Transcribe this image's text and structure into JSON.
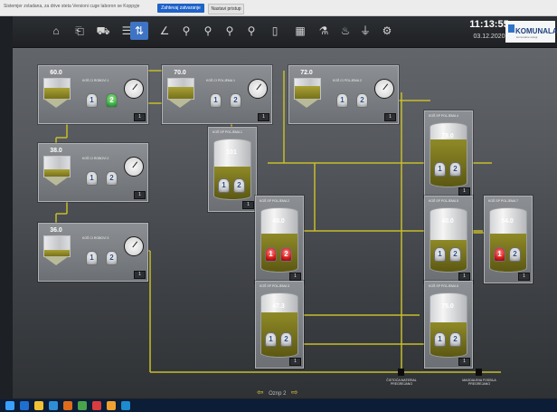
{
  "top_bar": {
    "message": "Sistemjer zvladana, za drive steta Versioni cuge laboron se Koppyje",
    "primary_button": "Zahtevaj zatvaranje",
    "secondary_button": "Nastavi pristup"
  },
  "toolbar": {
    "icons": [
      "home-icon",
      "exit-icon",
      "truck-icon",
      "list-icon",
      "flow-icon",
      "line-chart-icon",
      "zoom-icon",
      "zoom-icon",
      "zoom-icon",
      "zoom-icon",
      "document-icon",
      "grid-icon",
      "lab-icon",
      "alarm-icon",
      "plug-icon",
      "settings-icon"
    ],
    "time": "11:13:55",
    "date": "03.12.2020"
  },
  "logo": {
    "text": "KOMUNALA",
    "tagline": "komunalne uslugi"
  },
  "units": {
    "bin1": {
      "title": "KOŠ CI ROBOVI 1",
      "value": "60.0",
      "fill": 0.55,
      "pumps": [
        "1",
        "2"
      ],
      "badge": "1"
    },
    "bin2": {
      "title": "KOŠ CI POLJEMA 1",
      "value": "70.0",
      "fill": 0.6,
      "pumps": [
        "1",
        "2"
      ],
      "badge": "1"
    },
    "bin3": {
      "title": "KOŠ CI POLJEMA 2",
      "value": "72.0",
      "fill": 0.65,
      "pumps": [
        "1",
        "2"
      ],
      "badge": "1"
    },
    "bin4": {
      "title": "KOŠ CI ROBOVI 2",
      "value": "38.0",
      "fill": 0.35,
      "pumps": [
        "1",
        "2"
      ],
      "badge": "1"
    },
    "bin5": {
      "title": "KOŠ CI ROBOVI 3",
      "value": "36.0",
      "fill": 0.32,
      "pumps": [
        "1",
        "2"
      ],
      "badge": "1"
    }
  },
  "silos": {
    "s1": {
      "title": "KOŠ SP POLJEMA 1",
      "value": "101",
      "fill": 0.55,
      "pumps": [
        "1",
        "2"
      ],
      "badge": "1"
    },
    "s2": {
      "title": "KOŠ SP POLJEMA 2",
      "value": "40.0",
      "fill": 0.6,
      "pumps": [
        "1",
        "2"
      ],
      "badge": "1"
    },
    "s3": {
      "title": "KOŠ SP POLJEMA 3",
      "value": "47.3",
      "fill": 0.7,
      "pumps": [
        "1",
        "2"
      ],
      "badge": "1"
    },
    "s4": {
      "title": "KOŠ SP POLJEMA 4",
      "value": "78.0",
      "fill": 0.75,
      "pumps": [
        "1",
        "2"
      ],
      "badge": "1"
    },
    "s5": {
      "title": "KOŠ SP POLJEMA 5",
      "value": "40.0",
      "fill": 0.5,
      "pumps": [
        "1",
        "2"
      ],
      "badge": "1"
    },
    "s6": {
      "title": "KOŠ SP POLJEMA 6",
      "value": "75.0",
      "fill": 0.55,
      "pumps": [
        "1",
        "2"
      ],
      "badge": "1"
    },
    "s7": {
      "title": "KOŠ SP POLJEMA 7",
      "value": "54.0",
      "fill": 0.6,
      "pumps": [
        "1",
        "2"
      ],
      "badge": "1"
    }
  },
  "navigation": {
    "label": "Oznp 2"
  },
  "outputs": {
    "left": "ČISTOĆA MATERIAL\nPREGREJANO",
    "right": "MAGDALENA FOSSILA\nPREGREJANO"
  },
  "colors": {
    "pipe": "#c7bd2a",
    "fill": "#8a8423",
    "alarm": "#d41b1b",
    "run": "#3db14a"
  }
}
